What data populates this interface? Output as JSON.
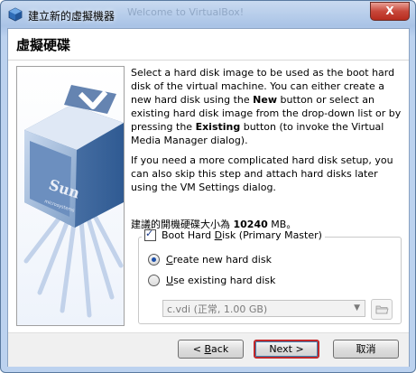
{
  "window": {
    "title": "建立新的虛擬機器",
    "ghost_title": "Welcome to VirtualBox!",
    "close_label": "X"
  },
  "header": {
    "title": "虛擬硬碟"
  },
  "description": {
    "p1_a": "Select a hard disk image to be used as the boot hard disk of the virtual machine. You can either create a new hard disk using the ",
    "p1_new": "New",
    "p1_b": " button or select an existing hard disk image from the drop-down list or by pressing the ",
    "p1_existing": "Existing",
    "p1_c": " button (to invoke the Virtual Media Manager dialog).",
    "p2": "If you need a more complicated hard disk setup, you can also skip this step and attach hard disks later using the VM Settings dialog."
  },
  "recommended": {
    "prefix": "建議的開機硬碟大小為 ",
    "size": "10240",
    "suffix": " MB。"
  },
  "boot_disk": {
    "checkbox_a": "Boot Hard ",
    "checkbox_u": "D",
    "checkbox_b": "isk (Primary Master)",
    "create_u": "C",
    "create_rest": "reate new hard disk",
    "existing_u": "U",
    "existing_rest": "se existing hard disk",
    "combo_value": "c.vdi (正常, 1.00 GB)"
  },
  "buttons": {
    "back_prefix": "< ",
    "back_u": "B",
    "back_rest": "ack",
    "next_label": "Next >",
    "cancel_label": "取消"
  },
  "colors": {
    "accent": "#1d4fa8",
    "default_border": "#c0282a"
  }
}
